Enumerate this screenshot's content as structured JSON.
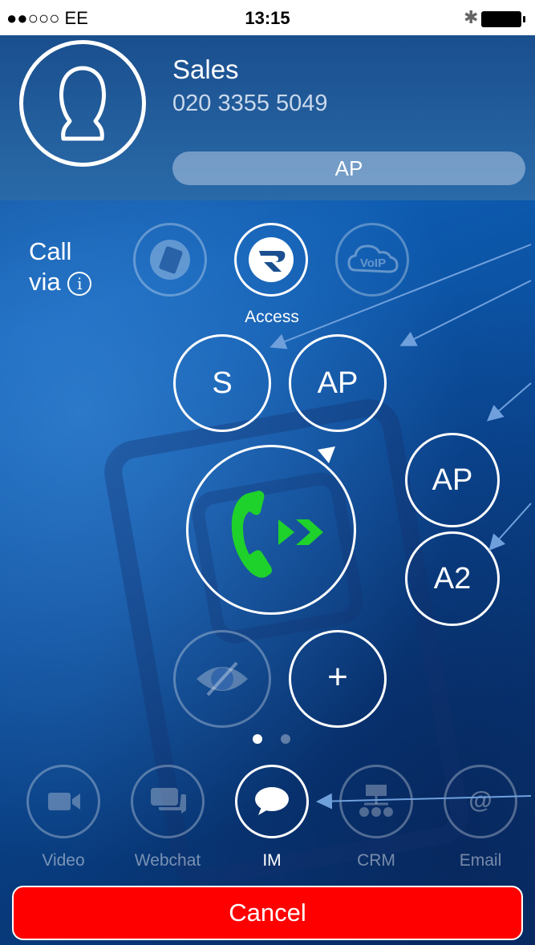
{
  "status_bar": {
    "carrier": "●●○○○ EE",
    "time": "13:15"
  },
  "contact": {
    "name": "Sales",
    "phone": "020 3355 5049",
    "group": "AP"
  },
  "call_via": {
    "label_line1": "Call",
    "label_line2": "via",
    "info_glyph": "i",
    "options": [
      {
        "icon": "sim-card-icon",
        "active": false
      },
      {
        "icon": "access-r-icon",
        "label": "Access",
        "active": true
      },
      {
        "icon": "voip-cloud-icon",
        "icon_text": "VoIP",
        "active": false
      }
    ]
  },
  "identities": [
    {
      "label": "S"
    },
    {
      "label": "AP"
    },
    {
      "label": "AP"
    },
    {
      "label": "A2"
    }
  ],
  "controls": {
    "call_icon": "phone-forward-icon",
    "hide_icon": "eye-slash-icon",
    "add_label": "+"
  },
  "pager": {
    "count": 2,
    "active": 0
  },
  "channels": [
    {
      "label": "Video",
      "icon": "video-camera-icon",
      "active": false
    },
    {
      "label": "Webchat",
      "icon": "webchat-icon",
      "active": false
    },
    {
      "label": "IM",
      "icon": "chat-bubble-icon",
      "active": true
    },
    {
      "label": "CRM",
      "icon": "crm-network-icon",
      "active": false
    },
    {
      "label": "Email",
      "icon": "at-sign-icon",
      "active": false
    }
  ],
  "cancel_label": "Cancel",
  "colors": {
    "call_green": "#1fd12b",
    "cancel_red": "#ff0000",
    "annotation_arrow": "#6fa0dc"
  }
}
